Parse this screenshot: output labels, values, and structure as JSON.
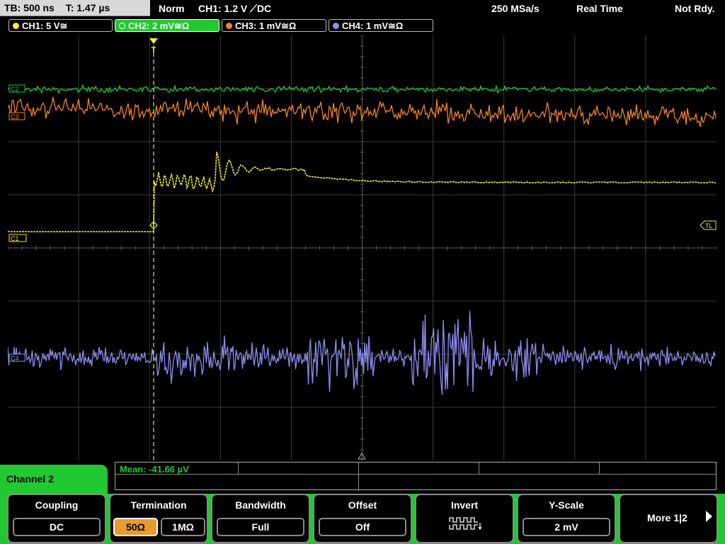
{
  "topbar": {
    "timebase": "TB: 500 ns",
    "trigger_time": "T: 1.47 µs",
    "mode": "Norm",
    "trigger": "CH1: 1.2 V ⟋DC",
    "sample_rate": "250 MSa/s",
    "acq_mode": "Real Time",
    "status": "Not Rdy."
  },
  "channels": [
    {
      "label": "CH1: 5 V≅",
      "color": "#f1ee3a",
      "active": false
    },
    {
      "label": "CH2: 2 mV≅Ω",
      "color": "#22c831",
      "active": true
    },
    {
      "label": "CH3: 1 mV≅Ω",
      "color": "#f2832c",
      "active": false
    },
    {
      "label": "CH4: 1 mV≅Ω",
      "color": "#8e8ef0",
      "active": false
    }
  ],
  "markers": {
    "c2": "C2",
    "c3": "C3",
    "c1": "C1",
    "c4": "C4",
    "tl": "TL",
    "t": "T"
  },
  "panel": {
    "channel_title": "Channel 2",
    "measurement": "Mean: -41.66 µV"
  },
  "softkeys": {
    "coupling": {
      "label": "Coupling",
      "value": "DC"
    },
    "termination": {
      "label": "Termination",
      "opt1": "50Ω",
      "opt2": "1MΩ",
      "selected": "50Ω"
    },
    "bandwidth": {
      "label": "Bandwidth",
      "value": "Full"
    },
    "offset": {
      "label": "Offset",
      "value": "Off"
    },
    "invert": {
      "label": "Invert",
      "icon": "invert-waveform-icon"
    },
    "yscale": {
      "label": "Y-Scale",
      "value": "2 mV"
    },
    "more": {
      "label": "More 1|2",
      "icon": "arrow-right-icon"
    }
  }
}
